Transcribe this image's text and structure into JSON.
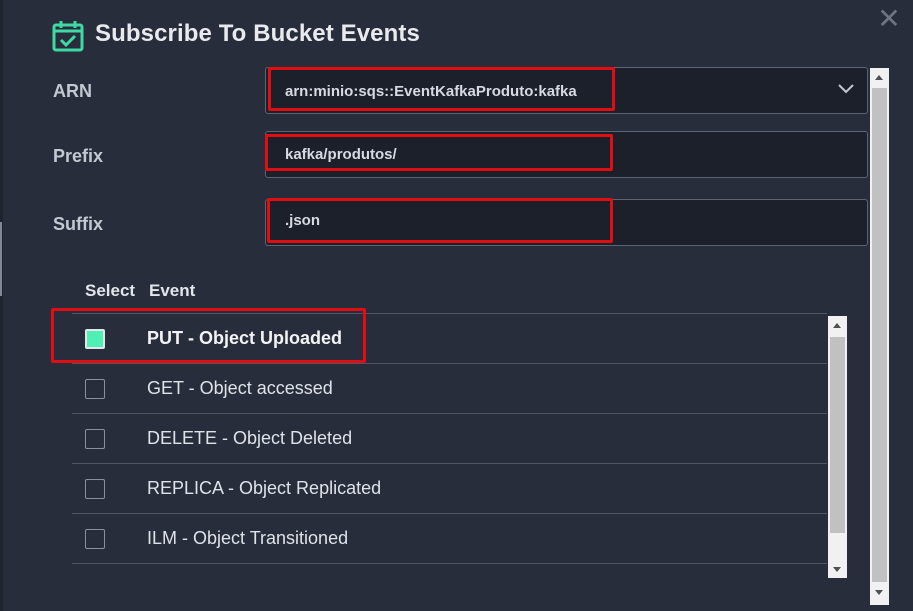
{
  "dialog": {
    "title": "Subscribe To Bucket Events",
    "header_icon": "calendar-check-icon",
    "close_icon": "close-icon",
    "close_glyph": "✕"
  },
  "form": {
    "arn": {
      "label": "ARN",
      "value": "arn:minio:sqs::EventKafkaProduto:kafka"
    },
    "prefix": {
      "label": "Prefix",
      "value": "kafka/produtos/"
    },
    "suffix": {
      "label": "Suffix",
      "value": ".json"
    }
  },
  "events_table": {
    "headers": {
      "select": "Select",
      "event": "Event"
    },
    "rows": [
      {
        "label": "PUT - Object Uploaded",
        "checked": true
      },
      {
        "label": "GET - Object accessed",
        "checked": false
      },
      {
        "label": "DELETE - Object Deleted",
        "checked": false
      },
      {
        "label": "REPLICA - Object Replicated",
        "checked": false
      },
      {
        "label": "ILM - Object Transitioned",
        "checked": false
      }
    ]
  },
  "colors": {
    "accent": "#4ff0b4",
    "highlight": "#e00d12",
    "background": "#272d3b",
    "field_background": "#1b202b"
  }
}
